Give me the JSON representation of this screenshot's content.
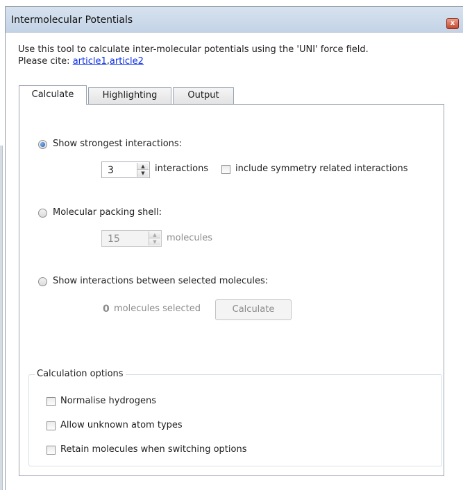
{
  "window": {
    "title": "Intermolecular Potentials",
    "close_glyph": "x"
  },
  "intro": {
    "line1": "Use this tool to calculate inter-molecular potentials using the 'UNI' force field.",
    "cite_prefix": "Please cite: ",
    "link1": "article1",
    "separator": ",",
    "link2": "article2"
  },
  "tabs": [
    {
      "label": "Calculate",
      "active": true
    },
    {
      "label": "Highlighting",
      "active": false
    },
    {
      "label": "Output",
      "active": false
    }
  ],
  "calculate": {
    "strongest": {
      "label": "Show strongest interactions:",
      "selected": true,
      "count": "3",
      "unit": "interactions",
      "symmetry_label": "include symmetry related interactions",
      "symmetry_checked": false
    },
    "packing": {
      "label": "Molecular packing shell:",
      "selected": false,
      "count": "15",
      "unit": "molecules"
    },
    "selected": {
      "label": "Show interactions between selected molecules:",
      "selected": false,
      "count": "0",
      "count_label": "molecules selected",
      "button": "Calculate"
    },
    "options": {
      "title": "Calculation options",
      "items": [
        {
          "label": "Normalise hydrogens",
          "checked": false
        },
        {
          "label": "Allow unknown atom types",
          "checked": false
        },
        {
          "label": "Retain molecules when switching options",
          "checked": false
        }
      ]
    }
  }
}
